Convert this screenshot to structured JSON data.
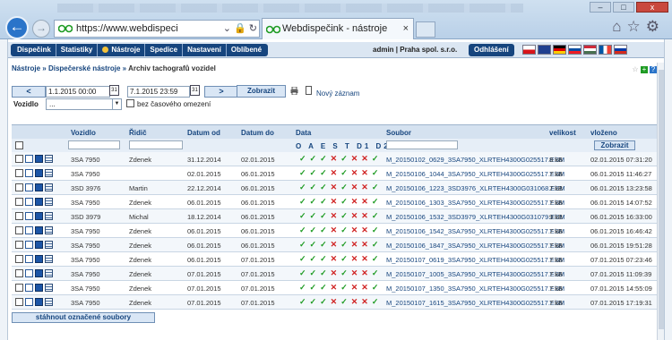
{
  "browser": {
    "url": "https://www.webdispeci",
    "tab_title": "Webdispečink - nástroje",
    "close_glyph": "×",
    "tools_glyphs": "⌂☆⚙",
    "nav_glyphs": "⌄ 🔒 ↻"
  },
  "menu": {
    "items": [
      "Dispečink",
      "Statistiky",
      "Nástroje",
      "Spedice",
      "Nastavení",
      "Oblíbené"
    ],
    "user": "admin | Praha spol. s.r.o.",
    "logout": "Odhlášení"
  },
  "languages": [
    "cs",
    "en",
    "de",
    "sk",
    "hu",
    "fr",
    "ru"
  ],
  "breadcrumb": {
    "l1": "Nástroje",
    "sep": "»",
    "l2": "Dispečerské nástroje",
    "l3": "Archiv tachografů vozidel"
  },
  "filter": {
    "prev": "<",
    "next": ">",
    "date_from": "1.1.2015 00:00",
    "date_to": "7.1.2015 23:59",
    "show": "Zobrazit",
    "new_record": "Nový záznam",
    "vehicle_label": "Vozidlo",
    "vehicle_value": "...",
    "no_time_limit": "bez časového omezení"
  },
  "table": {
    "headers": {
      "vehicle": "Vozidlo",
      "driver": "Řidič",
      "date_from": "Datum od",
      "date_to": "Datum do",
      "data": "Data",
      "file": "Soubor",
      "size": "velikost",
      "uploaded": "vloženo"
    },
    "data_letters": "O A E S T D1 D2 OK",
    "filter_button": "Zobrazit",
    "rows": [
      {
        "vehicle": "3SA 7950",
        "driver": "Zdenek",
        "from": "31.12.2014",
        "to": "02.01.2015",
        "flags": [
          1,
          1,
          1,
          0,
          1,
          0,
          0,
          1
        ],
        "file": "M_20150102_0629_3SA7950_XLRTEH4300G025517.ESM",
        "size": "8 kB",
        "uploaded": "02.01.2015 07:31:20"
      },
      {
        "vehicle": "3SA 7950",
        "driver": "",
        "from": "02.01.2015",
        "to": "06.01.2015",
        "flags": [
          1,
          1,
          1,
          0,
          1,
          0,
          0,
          1
        ],
        "file": "M_20150106_1044_3SA7950_XLRTEH4300G025517.ESM",
        "size": "7 kB",
        "uploaded": "06.01.2015 11:46:27"
      },
      {
        "vehicle": "3SD 3976",
        "driver": "Martin",
        "from": "22.12.2014",
        "to": "06.01.2015",
        "flags": [
          1,
          1,
          1,
          0,
          1,
          0,
          0,
          1
        ],
        "file": "M_20150106_1223_3SD3976_XLRTEH4300G031068.ESM",
        "size": "7 kB",
        "uploaded": "06.01.2015 13:23:58"
      },
      {
        "vehicle": "3SA 7950",
        "driver": "Zdenek",
        "from": "06.01.2015",
        "to": "06.01.2015",
        "flags": [
          1,
          1,
          1,
          0,
          1,
          0,
          0,
          1
        ],
        "file": "M_20150106_1303_3SA7950_XLRTEH4300G025517.ESM",
        "size": "7 kB",
        "uploaded": "06.01.2015 14:07:52"
      },
      {
        "vehicle": "3SD 3979",
        "driver": "Michal",
        "from": "18.12.2014",
        "to": "06.01.2015",
        "flags": [
          1,
          1,
          1,
          0,
          1,
          0,
          0,
          1
        ],
        "file": "M_20150106_1532_3SD3979_XLRTEH4300G031079.ESM",
        "size": "9 kB",
        "uploaded": "06.01.2015 16:33:00"
      },
      {
        "vehicle": "3SA 7950",
        "driver": "Zdenek",
        "from": "06.01.2015",
        "to": "06.01.2015",
        "flags": [
          1,
          1,
          1,
          0,
          1,
          0,
          0,
          1
        ],
        "file": "M_20150106_1542_3SA7950_XLRTEH4300G025517.ESM",
        "size": "7 kB",
        "uploaded": "06.01.2015 16:46:42"
      },
      {
        "vehicle": "3SA 7950",
        "driver": "Zdenek",
        "from": "06.01.2015",
        "to": "06.01.2015",
        "flags": [
          1,
          1,
          1,
          0,
          1,
          0,
          0,
          1
        ],
        "file": "M_20150106_1847_3SA7950_XLRTEH4300G025517.ESM",
        "size": "7 kB",
        "uploaded": "06.01.2015 19:51:28"
      },
      {
        "vehicle": "3SA 7950",
        "driver": "Zdenek",
        "from": "06.01.2015",
        "to": "07.01.2015",
        "flags": [
          1,
          1,
          1,
          0,
          1,
          0,
          0,
          1
        ],
        "file": "M_20150107_0619_3SA7950_XLRTEH4300G025517.ESM",
        "size": "7 kB",
        "uploaded": "07.01.2015 07:23:46"
      },
      {
        "vehicle": "3SA 7950",
        "driver": "Zdenek",
        "from": "07.01.2015",
        "to": "07.01.2015",
        "flags": [
          1,
          1,
          1,
          0,
          1,
          0,
          0,
          1
        ],
        "file": "M_20150107_1005_3SA7950_XLRTEH4300G025517.ESM",
        "size": "7 kB",
        "uploaded": "07.01.2015 11:09:39"
      },
      {
        "vehicle": "3SA 7950",
        "driver": "Zdenek",
        "from": "07.01.2015",
        "to": "07.01.2015",
        "flags": [
          1,
          1,
          1,
          0,
          1,
          0,
          0,
          1
        ],
        "file": "M_20150107_1350_3SA7950_XLRTEH4300G025517.ESM",
        "size": "7 kB",
        "uploaded": "07.01.2015 14:55:09"
      },
      {
        "vehicle": "3SA 7950",
        "driver": "Zdenek",
        "from": "07.01.2015",
        "to": "07.01.2015",
        "flags": [
          1,
          1,
          1,
          0,
          1,
          0,
          0,
          1
        ],
        "file": "M_20150107_1615_3SA7950_XLRTEH4300G025517.ESM",
        "size": "7 kB",
        "uploaded": "07.01.2015 17:19:31"
      }
    ]
  },
  "download_label": "stáhnout označené soubory",
  "colors": {
    "brand": "#16457e",
    "ok": "#1e9b23",
    "error": "#d02222"
  }
}
